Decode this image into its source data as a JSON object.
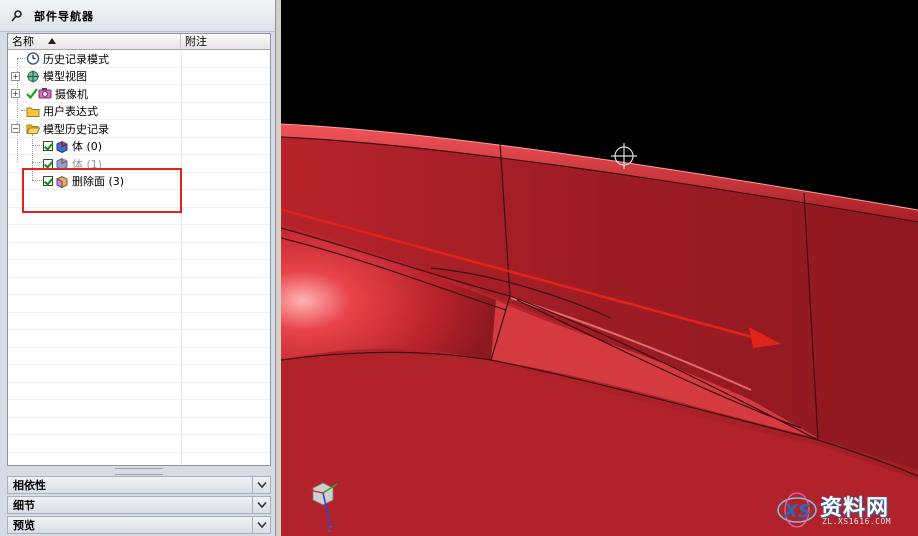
{
  "navigator": {
    "title": "部件导航器",
    "columns": {
      "name": "名称",
      "note": "附注"
    },
    "items": [
      {
        "label": "历史记录模式",
        "icon": "clock-icon"
      },
      {
        "label": "模型视图",
        "icon": "model-view-icon"
      },
      {
        "label": "摄像机",
        "icon": "camera-icon"
      },
      {
        "label": "用户表达式",
        "icon": "folder-icon"
      },
      {
        "label": "模型历史记录",
        "icon": "folder-open-icon"
      },
      {
        "label": "体 (0)",
        "icon": "body-feature-icon"
      },
      {
        "label": "体 (1)",
        "icon": "body-feature-icon"
      },
      {
        "label": "删除面 (3)",
        "icon": "delete-face-icon"
      }
    ],
    "sections": [
      {
        "label": "相依性"
      },
      {
        "label": "细节"
      },
      {
        "label": "预览"
      }
    ]
  },
  "viewport": {
    "background": "#000000",
    "model_color": "#b8222a",
    "annotation_color": "#e2231a",
    "watermark": {
      "main": "资料网",
      "sub": "ZL.XS1616.COM",
      "logo": "XS"
    }
  }
}
